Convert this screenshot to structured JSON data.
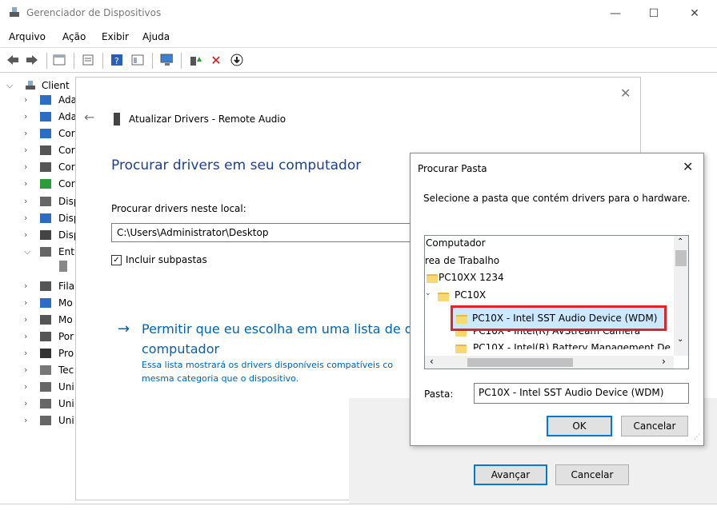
{
  "window": {
    "title": "Gerenciador de Dispositivos"
  },
  "menu": [
    "Arquivo",
    "Ação",
    "Exibir",
    "Ajuda"
  ],
  "tree": {
    "root": "Client",
    "items": [
      "Ada",
      "Ada",
      "Cor",
      "Cor",
      "Cor",
      "Cor",
      "Disp",
      "Disp",
      "Disp",
      "Entr",
      "Fila",
      "Mo",
      "Mo",
      "Por",
      "Pro",
      "Tec",
      "Uni",
      "Uni",
      "Uni"
    ]
  },
  "wizard": {
    "title": "Atualizar Drivers - Remote Audio",
    "heading": "Procurar drivers em seu computador",
    "search_label": "Procurar drivers neste local:",
    "path_value": "C:\\Users\\Administrator\\Desktop",
    "include_subfolders": "Incluir subpastas",
    "link_line1": "Permitir que eu escolha em uma lista de d",
    "link_line2": "computador",
    "desc_line1": "Essa lista mostrará os drivers disponíveis compatíveis co",
    "desc_line2": "mesma categoria que o dispositivo.",
    "next_button": "Avançar",
    "cancel_button": "Cancelar"
  },
  "browse": {
    "title": "Procurar Pasta",
    "description": "Selecione a pasta que contém drivers para o hardware.",
    "items": [
      "Computador",
      "rea de Trabalho",
      "PC10XX 1234",
      "PC10X",
      "PC10X - Intel SST Audio Device (WDM)",
      "PC10X - Intel(R) AVStream Camera",
      "PC10X - Intel(R) Battery Management De"
    ],
    "folder_label": "Pasta:",
    "folder_value": "PC10X - Intel SST Audio Device (WDM)",
    "ok_button": "OK",
    "cancel_button": "Cancelar"
  },
  "colors": {
    "link": "#0063b1",
    "heading": "#1c3f93",
    "highlight_border": "#e0242c",
    "selection": "#cce8ff"
  }
}
